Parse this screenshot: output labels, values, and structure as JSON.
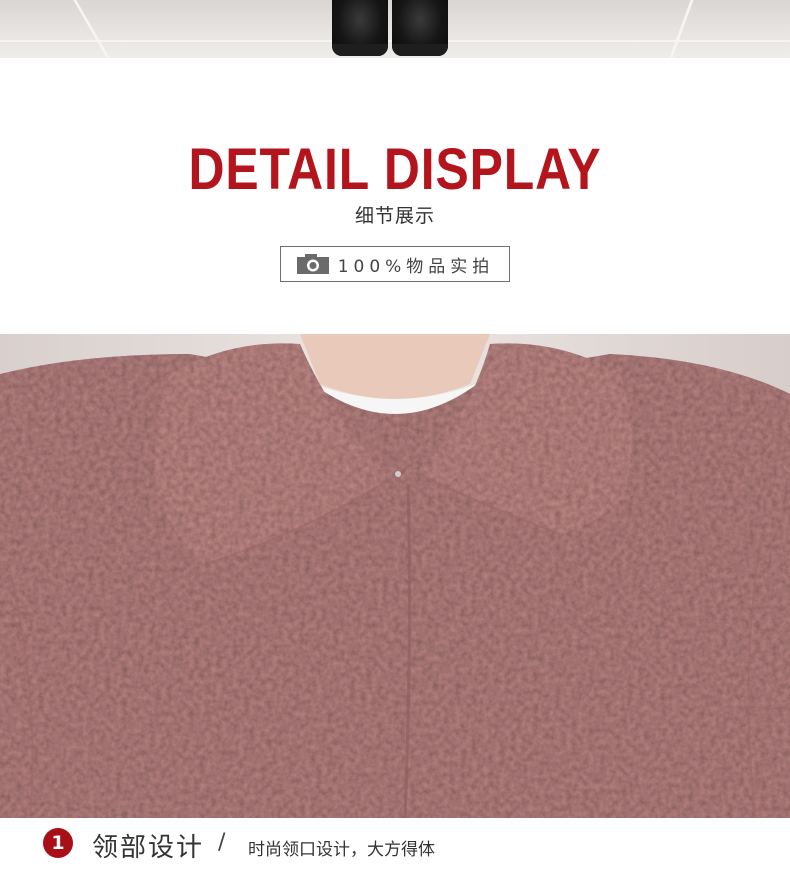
{
  "header": {
    "title": "DETAIL DISPLAY",
    "subtitle": "细节展示",
    "badge_text": "100%物品实拍"
  },
  "caption": {
    "number": "1",
    "title": "领部设计",
    "separator": "/",
    "description": "时尚领口设计，大方得体"
  },
  "colors": {
    "title_red": "#b4141c",
    "badge_red": "#a80f17",
    "coat_pink": "#b98382"
  },
  "icons": {
    "badge_icon": "camera-icon"
  }
}
